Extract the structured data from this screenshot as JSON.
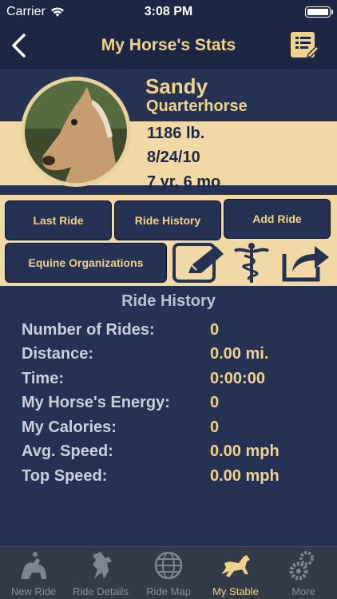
{
  "status": {
    "carrier": "Carrier",
    "time": "3:08 PM"
  },
  "nav": {
    "title": "My Horse's Stats"
  },
  "horse": {
    "name": "Sandy",
    "breed": "Quarterhorse",
    "weight": "1186 lb.",
    "birthdate": "8/24/10",
    "age": "7 yr, 6 mo"
  },
  "buttons": {
    "last_ride": "Last Ride",
    "ride_history": "Ride History",
    "add_ride": "Add Ride",
    "equine_orgs": "Equine Organizations"
  },
  "icons": [
    "edit-icon",
    "caduceus-icon",
    "share-icon"
  ],
  "history": {
    "title": "Ride History",
    "rows": [
      {
        "label": "Number of Rides:",
        "value": "0"
      },
      {
        "label": "Distance:",
        "value": "0.00 mi."
      },
      {
        "label": "Time:",
        "value": "0:00:00"
      },
      {
        "label": "My Horse's Energy:",
        "value": "0"
      },
      {
        "label": "My Calories:",
        "value": "0"
      },
      {
        "label": "Avg. Speed:",
        "value": "0.00 mph"
      },
      {
        "label": "Top Speed:",
        "value": "0.00 mph"
      }
    ]
  },
  "tabs": [
    {
      "label": "New Ride",
      "icon": "rider-icon"
    },
    {
      "label": "Ride Details",
      "icon": "rearing-horse-icon"
    },
    {
      "label": "Ride Map",
      "icon": "globe-icon"
    },
    {
      "label": "My Stable",
      "icon": "galloping-horse-icon",
      "active": true
    },
    {
      "label": "More",
      "icon": "gears-icon"
    }
  ],
  "colors": {
    "accent": "#f0d28a",
    "navy": "#263253",
    "cream": "#f0d9a4"
  }
}
